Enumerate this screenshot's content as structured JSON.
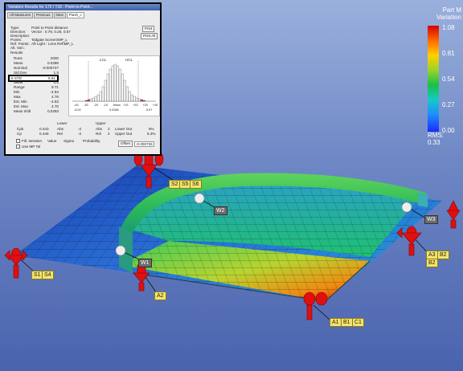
{
  "dialog": {
    "title": "Variation Results for 172 / T16 : Point-to-Point...",
    "tabs": [
      "All Measures",
      "Previous",
      "Next",
      "Plush_c"
    ],
    "info": [
      {
        "key": "Type:",
        "value": "Point to Point distance"
      },
      {
        "key": "Direction:",
        "value": "Vector : 0.78, 0.26, 0.57"
      },
      {
        "key": "Description:",
        "value": ""
      },
      {
        "key": "Points:",
        "value": "Tailgate Screen\\MP_L"
      },
      {
        "key": "Ref. Points:",
        "value": "Aft Light - Lens Ref\\MP_L"
      },
      {
        "key": "Alt. Vari.:",
        "value": ""
      }
    ],
    "buttons": {
      "print": "Print",
      "print_all": "Print All",
      "offset": "Offset"
    },
    "results_label": "Results",
    "results": [
      {
        "label": "Runs",
        "value": "2000"
      },
      {
        "label": "Mean",
        "value": "0.0288"
      },
      {
        "label": "Nominal",
        "value": "-0.000727"
      },
      {
        "label": "Std Dev",
        "value": "1.5"
      },
      {
        "label": "6 STD",
        "value": "8.81"
      },
      {
        "label": "Skew",
        "value": "0.0"
      },
      {
        "label": "Range",
        "value": "9.71"
      },
      {
        "label": "Min",
        "value": "-4.94"
      },
      {
        "label": "Max",
        "value": "4.76"
      },
      {
        "label": "Est. Min",
        "value": "-4.63"
      },
      {
        "label": "Est. Max",
        "value": "4.70"
      },
      {
        "label": "Mean shift",
        "value": "0.0293"
      }
    ],
    "hist": {
      "lcl": "LCL",
      "ucl": "UCL",
      "xticks": [
        "-4S",
        "-3S",
        "-2S",
        "-1S",
        "Mean",
        "+1S",
        "+2S",
        "+3S",
        "+4S"
      ],
      "xvals": [
        "-5.92",
        "0.0288",
        "5.97"
      ]
    },
    "bottom": {
      "lower": "Lower",
      "upper": "Upper",
      "rows": [
        {
          "label": "Cpk",
          "val": "0.443",
          "a": "Abs",
          "b": "-2",
          "c": "Abs",
          "d": "2",
          "e": "Lower Out",
          "f": "6%"
        },
        {
          "label": "Cp",
          "val": "0.445",
          "a": "Rel",
          "b": "-2",
          "c": "Rel",
          "d": "2",
          "e": "Upper Out",
          "f": "6.3%"
        }
      ],
      "fill_iteration": "Fill. Iteration",
      "use_mp_tol": "Use MP Tol",
      "col_value": "Value",
      "col_sigma": "Sigma",
      "col_probability": "Probability",
      "offset_value": "-0.000726"
    }
  },
  "legend": {
    "title": "Part M\nVariation",
    "ticks": [
      "1.08",
      "0.81",
      "0.54",
      "0.27",
      "0.00"
    ],
    "rms_label": "RMS:",
    "rms_value": "0.33"
  },
  "scene": {
    "tags": [
      "S2",
      "S5",
      "S6",
      "W2",
      "W3",
      "A3",
      "B2",
      "B2",
      "W1",
      "S1",
      "S4",
      "A2",
      "A1",
      "B1",
      "C1"
    ],
    "colors": {
      "plate_blue": "#1e4db8",
      "wall_green": "#2ab85a",
      "pin_red": "#e01010",
      "tag_yellow": "#f4e46a"
    }
  }
}
